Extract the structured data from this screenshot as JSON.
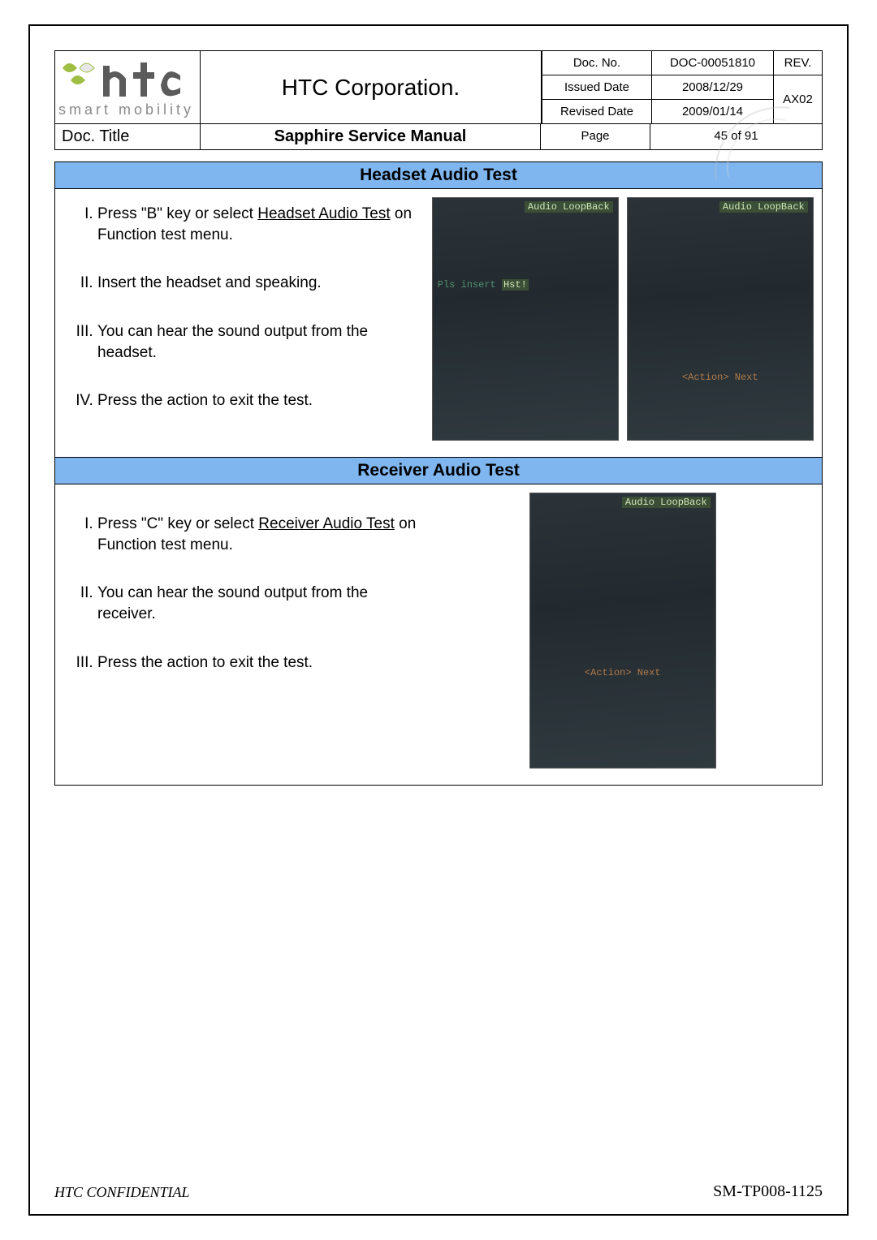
{
  "header": {
    "logo_tagline": "smart mobility",
    "corporation": "HTC Corporation.",
    "meta": {
      "doc_no_label": "Doc. No.",
      "doc_no": "DOC-00051810",
      "rev_label": "REV.",
      "rev": "AX02",
      "issued_date_label": "Issued Date",
      "issued_date": "2008/12/29",
      "revised_date_label": "Revised Date",
      "revised_date": "2009/01/14"
    },
    "title_label": "Doc. Title",
    "title": "Sapphire Service Manual",
    "page_label": "Page",
    "page_value": "45 of 91"
  },
  "sections": {
    "headset": {
      "heading": "Headset Audio Test",
      "steps": {
        "s1_pre": "Press \"B\" key or select ",
        "s1_link": "Headset Audio Test",
        "s1_post": " on Function test menu.",
        "s2": "Insert the headset and speaking.",
        "s3": "You can hear the sound output from the headset.",
        "s4": "Press the action to exit the test."
      },
      "screen_a": {
        "title": "Audio  LoopBack",
        "mid_pre": "Pls insert ",
        "mid_hl": "Hst!",
        "action": ""
      },
      "screen_b": {
        "title": "Audio  LoopBack",
        "action": "<Action> Next"
      }
    },
    "receiver": {
      "heading": "Receiver Audio Test",
      "steps": {
        "s1_pre": "Press \"C\" key or select ",
        "s1_link": "Receiver Audio Test",
        "s1_post": " on Function test menu.",
        "s2": "You can hear the sound output from the receiver.",
        "s3": "Press the action to exit the test."
      },
      "screen": {
        "title": "Audio  LoopBack",
        "action": "<Action> Next"
      }
    }
  },
  "footer": {
    "left": "HTC CONFIDENTIAL",
    "right": "SM-TP008-1125"
  }
}
